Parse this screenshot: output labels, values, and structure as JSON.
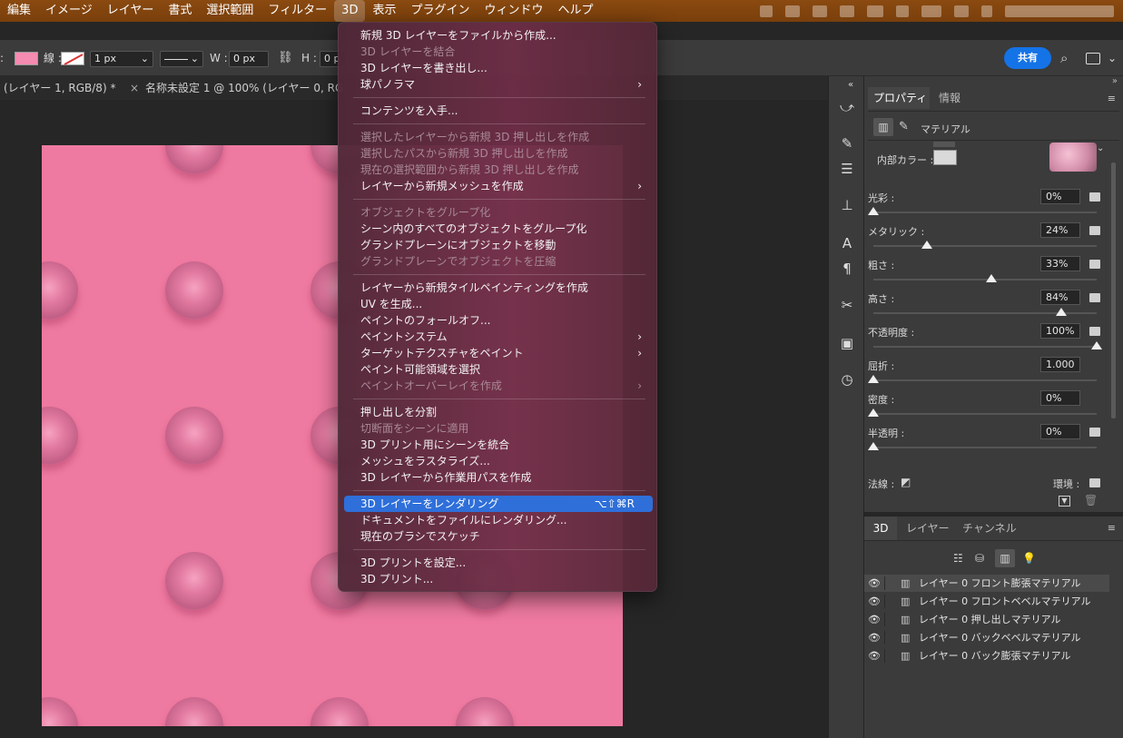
{
  "menubar": {
    "items": [
      "編集",
      "イメージ",
      "レイヤー",
      "書式",
      "選択範囲",
      "フィルター",
      "3D",
      "表示",
      "プラグイン",
      "ウィンドウ",
      "ヘルプ"
    ],
    "active": "3D"
  },
  "options_bar": {
    "stroke_label": "線 :",
    "stroke_width": "1 px",
    "w_label": "W :",
    "w_value": "0 px",
    "h_label": "H :",
    "h_value": "0 p",
    "share_label": "共有",
    "fill_color": "#f48bb0"
  },
  "tabs": {
    "tab1": "(レイヤー 1, RGB/8) *",
    "tab2_close": "×",
    "tab2": "名称未設定 1 @ 100% (レイヤー 0, RG"
  },
  "canvas": {
    "color": "#ef7aa1"
  },
  "menu_3d": {
    "items": [
      {
        "label": "新規 3D レイヤーをファイルから作成...",
        "disabled": false
      },
      {
        "label": "3D レイヤーを結合",
        "disabled": true
      },
      {
        "label": "3D レイヤーを書き出し...",
        "disabled": false
      },
      {
        "label": "球パノラマ",
        "disabled": false,
        "submenu": true
      },
      {
        "label": "コンテンツを入手...",
        "disabled": false
      },
      {
        "label": "選択したレイヤーから新規 3D 押し出しを作成",
        "disabled": true
      },
      {
        "label": "選択したパスから新規 3D 押し出しを作成",
        "disabled": true
      },
      {
        "label": "現在の選択範囲から新規 3D 押し出しを作成",
        "disabled": true
      },
      {
        "label": "レイヤーから新規メッシュを作成",
        "disabled": false,
        "submenu": true
      },
      {
        "label": "オブジェクトをグループ化",
        "disabled": true
      },
      {
        "label": "シーン内のすべてのオブジェクトをグループ化",
        "disabled": false
      },
      {
        "label": "グランドプレーンにオブジェクトを移動",
        "disabled": false
      },
      {
        "label": "グランドプレーンでオブジェクトを圧縮",
        "disabled": true
      },
      {
        "label": "レイヤーから新規タイルペインティングを作成",
        "disabled": false
      },
      {
        "label": "UV を生成...",
        "disabled": false
      },
      {
        "label": "ペイントのフォールオフ...",
        "disabled": false
      },
      {
        "label": "ペイントシステム",
        "disabled": false,
        "submenu": true
      },
      {
        "label": "ターゲットテクスチャをペイント",
        "disabled": false,
        "submenu": true
      },
      {
        "label": "ペイント可能領域を選択",
        "disabled": false
      },
      {
        "label": "ペイントオーバーレイを作成",
        "disabled": true,
        "submenu": true
      },
      {
        "label": "押し出しを分割",
        "disabled": false
      },
      {
        "label": "切断面をシーンに適用",
        "disabled": true
      },
      {
        "label": "3D プリント用にシーンを統合",
        "disabled": false
      },
      {
        "label": "メッシュをラスタライズ...",
        "disabled": false
      },
      {
        "label": "3D レイヤーから作業用パスを作成",
        "disabled": false
      },
      {
        "label": "3D レイヤーをレンダリング",
        "disabled": false,
        "selected": true,
        "shortcut": "⌥⇧⌘R"
      },
      {
        "label": "ドキュメントをファイルにレンダリング...",
        "disabled": false
      },
      {
        "label": "現在のブラシでスケッチ",
        "disabled": false
      },
      {
        "label": "3D プリントを設定...",
        "disabled": false
      },
      {
        "label": "3D プリント...",
        "disabled": false
      }
    ]
  },
  "properties": {
    "tabs": [
      "プロパティ",
      "情報"
    ],
    "section": "マテリアル",
    "inner_color_label": "内部カラー :",
    "rows": [
      {
        "label": "光彩 :",
        "value": "0%",
        "fraction": 0.0
      },
      {
        "label": "メタリック :",
        "value": "24%",
        "fraction": 0.24
      },
      {
        "label": "粗さ :",
        "value": "33%",
        "fraction": 0.53
      },
      {
        "label": "高さ :",
        "value": "84%",
        "fraction": 0.84
      },
      {
        "label": "不透明度 :",
        "value": "100%",
        "fraction": 1.0
      },
      {
        "label": "屈折 :",
        "value": "1.000",
        "fraction": 0.0
      },
      {
        "label": "密度 :",
        "value": "0%",
        "fraction": 0.0
      },
      {
        "label": "半透明 :",
        "value": "0%",
        "fraction": 0.0
      }
    ],
    "normal_label": "法線 :",
    "env_label": "環境 :"
  },
  "panel3d": {
    "tabs": [
      "3D",
      "レイヤー",
      "チャンネル"
    ],
    "layers": [
      "レイヤー 0 フロント膨張マテリアル",
      "レイヤー 0 フロントベベルマテリアル",
      "レイヤー 0 押し出しマテリアル",
      "レイヤー 0 バックベベルマテリアル",
      "レイヤー 0 バック膨張マテリアル"
    ]
  }
}
